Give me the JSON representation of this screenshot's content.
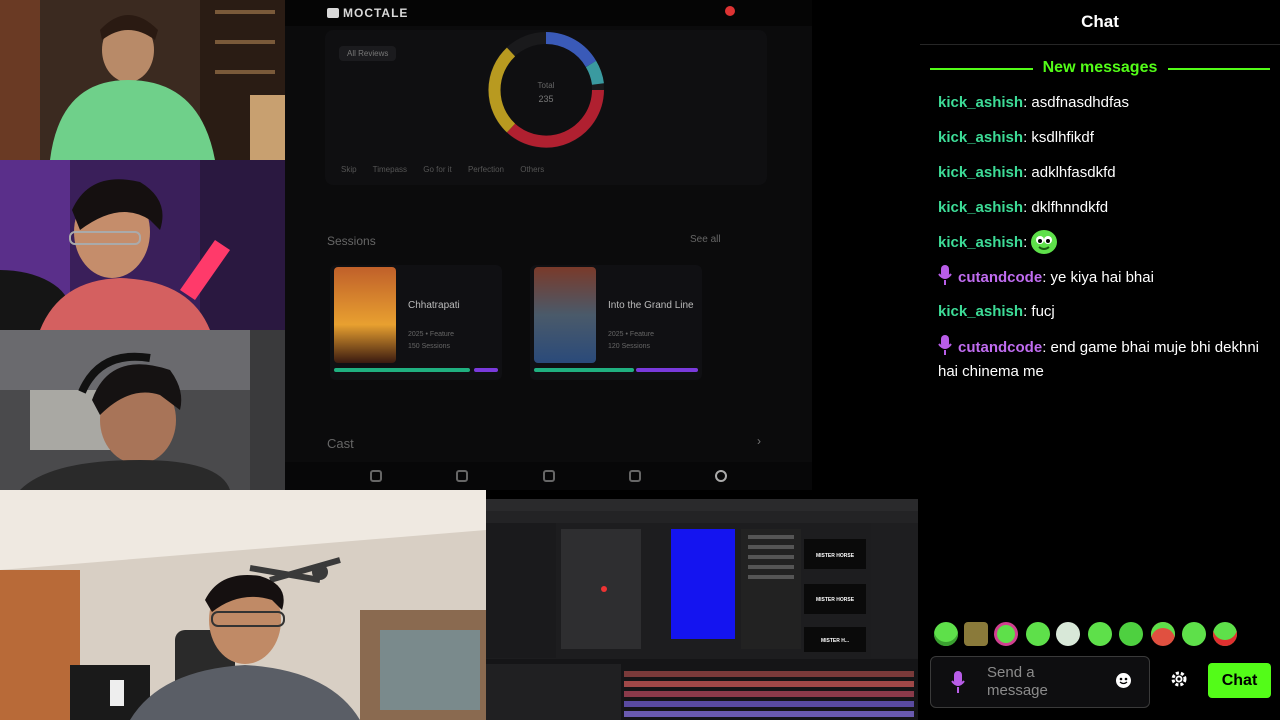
{
  "app": {
    "logo": "MOCTALE",
    "filter_chip": "All Reviews",
    "donut_label_top": "Total",
    "donut_label_bottom": "235",
    "legend": [
      "Skip",
      "Timepass",
      "Go for it",
      "Perfection",
      "Others"
    ],
    "sessions_title": "Sessions",
    "see_all": "See all",
    "cards": [
      {
        "title": "Chhatrapati",
        "meta1": "2025 • Feature",
        "meta2": "150 Sessions",
        "progress_green": 0.82,
        "progress_purple": 0.14
      },
      {
        "title": "Into the Grand Line",
        "meta1": "2025 • Feature",
        "meta2": "120 Sessions",
        "progress_green": 0.6,
        "progress_purple": 0.38
      }
    ],
    "cast_title": "Cast",
    "nav_icons": [
      "home-icon",
      "calendar-icon",
      "pen-icon",
      "bookmark-icon",
      "profile-icon"
    ]
  },
  "editor": {
    "preview_top": "MISTER HORSE",
    "preview_mid": "MISTER HORSE",
    "preview_bot": "MISTER H..."
  },
  "chat": {
    "title": "Chat",
    "new_messages_label": "New messages",
    "messages": [
      {
        "user": "kick_ashish",
        "text": "asdfnasdhdfas",
        "badge": false,
        "color": "#3ddc97"
      },
      {
        "user": "kick_ashish",
        "text": "ksdlhfikdf",
        "badge": false,
        "color": "#3ddc97"
      },
      {
        "user": "kick_ashish",
        "text": "adklhfasdkfd",
        "badge": false,
        "color": "#3ddc97"
      },
      {
        "user": "kick_ashish",
        "text": "dklfhnndkfd",
        "badge": false,
        "color": "#3ddc97"
      },
      {
        "user": "kick_ashish",
        "text": "",
        "badge": false,
        "emote": "green-blob-emote",
        "color": "#3ddc97"
      },
      {
        "user": "cutandcode",
        "text": "ye kiya hai bhai",
        "badge": true,
        "color": "#c06cf0"
      },
      {
        "user": "kick_ashish",
        "text": "fucj",
        "badge": false,
        "color": "#3ddc97"
      },
      {
        "user": "cutandcode",
        "text": "end game bhai muje bhi dekhni hai chinema me",
        "badge": true,
        "color": "#c06cf0"
      }
    ],
    "emotes": [
      "halo-blob-emote",
      "box-emote",
      "clown-blob-emote",
      "grin-blob-emote",
      "skull-blob-emote",
      "happy-blob-emote",
      "smile-blob-emote",
      "red-blob-emote",
      "tongue-blob-emote",
      "angry-blob-emote"
    ],
    "input_placeholder": "Send a message",
    "send_label": "Chat",
    "accent": "#53fc18"
  }
}
